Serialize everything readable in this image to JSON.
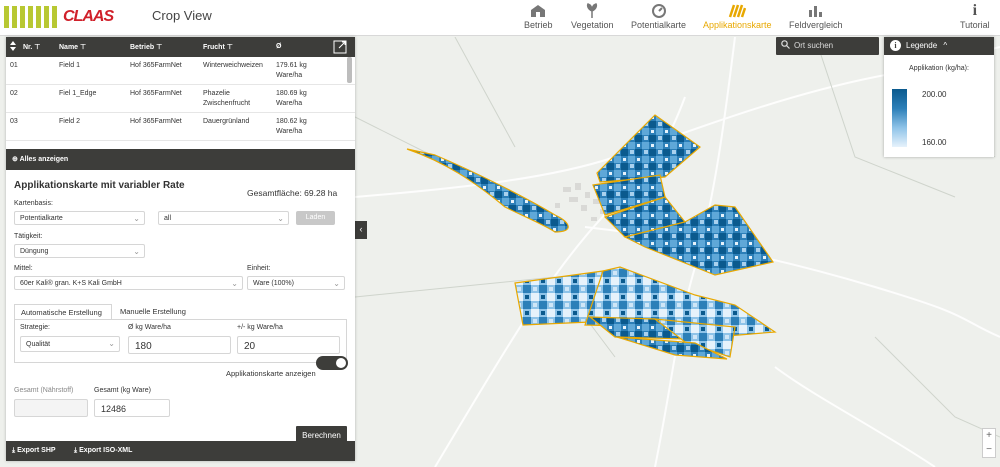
{
  "header": {
    "brand": "CLAAS",
    "app_title": "Crop View"
  },
  "nav": [
    {
      "label": "Betrieb",
      "icon": "barn-icon",
      "active": false
    },
    {
      "label": "Vegetation",
      "icon": "plant-icon",
      "active": false
    },
    {
      "label": "Potentialkarte",
      "icon": "potential-icon",
      "active": false
    },
    {
      "label": "Applikationskarte",
      "icon": "application-map-icon",
      "active": true
    },
    {
      "label": "Feldvergleich",
      "icon": "compare-chart-icon",
      "active": false
    },
    {
      "label": "Tutorial",
      "icon": "info-icon",
      "active": false
    }
  ],
  "table": {
    "headers": {
      "nr": "Nr.",
      "name": "Name",
      "betrieb": "Betrieb",
      "frucht": "Frucht",
      "avg": "Ø"
    },
    "rows": [
      {
        "nr": "01",
        "name": "Field 1",
        "betrieb": "Hof 365FarmNet",
        "frucht": "Winterweichweizen",
        "avg": "179.61 kg Ware/ha"
      },
      {
        "nr": "02",
        "name": "Fiel 1_Edge",
        "betrieb": "Hof 365FarmNet",
        "frucht": "Phazelie Zwischenfrucht",
        "avg": "180.69 kg Ware/ha"
      },
      {
        "nr": "03",
        "name": "Field 2",
        "betrieb": "Hof 365FarmNet",
        "frucht": "Dauergrünland",
        "avg": "180.62 kg Ware/ha"
      }
    ],
    "show_all": "Alles anzeigen"
  },
  "form": {
    "title": "Applikationskarte mit variabler Rate",
    "area": "Gesamtfläche: 69.28 ha",
    "kartenbasis_label": "Kartenbasis:",
    "kartenbasis_value": "Potentialkarte",
    "filter_value": "all",
    "load_button": "Laden",
    "taetigkeit_label": "Tätigkeit:",
    "taetigkeit_value": "Düngung",
    "mittel_label": "Mittel:",
    "mittel_value": "60er Kali® gran. K+S Kali GmbH",
    "einheit_label": "Einheit:",
    "einheit_value": "Ware (100%)",
    "tab_auto": "Automatische Erstellung",
    "tab_manual": "Manuelle Erstellung",
    "strategie_label": "Strategie:",
    "strategie_value": "Qualität",
    "avg_label": "Ø kg Ware/ha",
    "avg_value": "180",
    "delta_label": "+/- kg Ware/ha",
    "delta_value": "20",
    "show_map_label": "Applikationskarte anzeigen",
    "total_nutrient_label": "Gesamt (Nährstoff)",
    "total_nutrient_value": "",
    "total_goods_label": "Gesamt (kg Ware)",
    "total_goods_value": "12486",
    "calc_button": "Berechnen"
  },
  "footer": {
    "export_shp": "Export SHP",
    "export_iso": "Export ISO-XML"
  },
  "map": {
    "search_placeholder": "Ort suchen",
    "legend_title": "Legende",
    "legend_unit": "Applikation (kg/ha):",
    "legend_max": "200.00",
    "legend_min": "160.00",
    "zoom_in": "+",
    "zoom_out": "−",
    "colors": {
      "high": "#0b5a8e",
      "low": "#e6f2fb",
      "field_border": "#e8a800"
    }
  }
}
